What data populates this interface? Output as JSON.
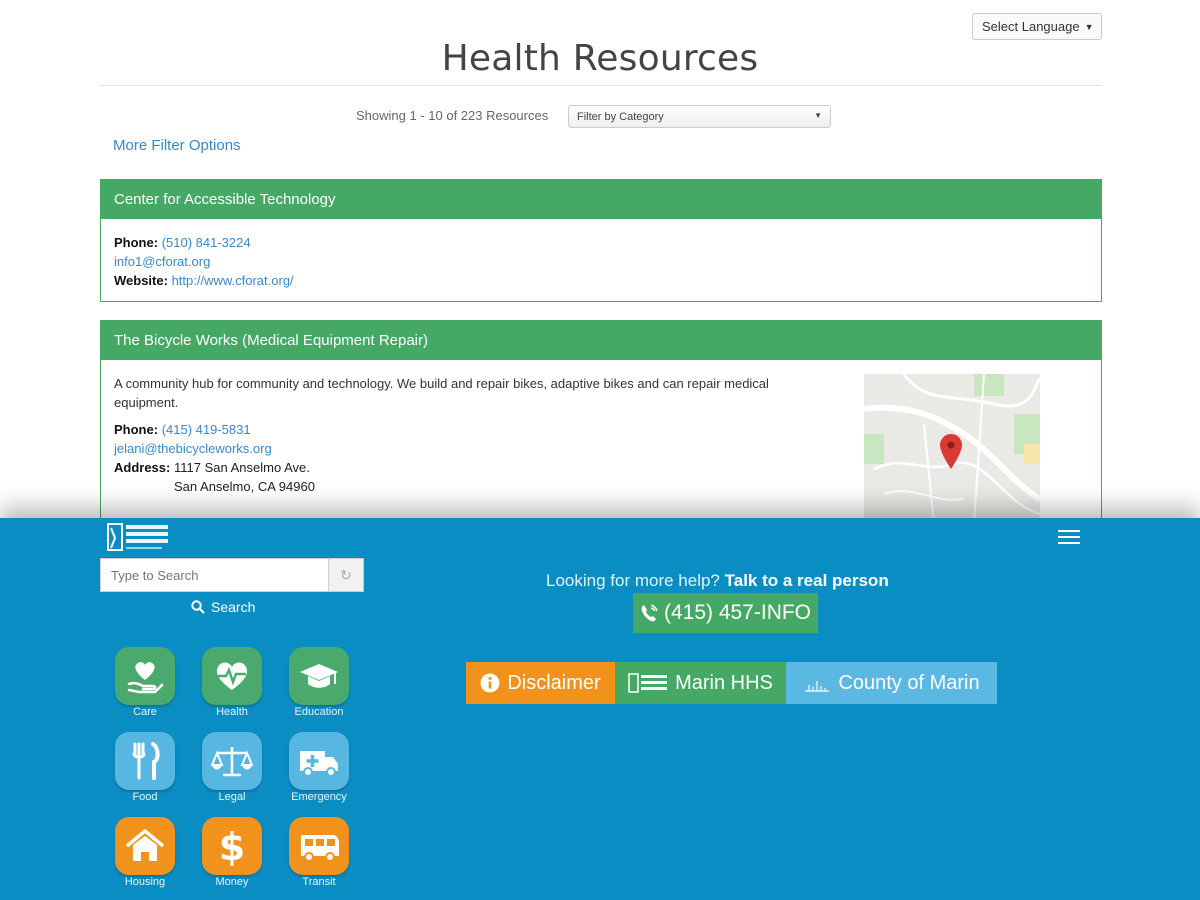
{
  "language_select": {
    "label": "Select Language"
  },
  "page": {
    "title": "Health Resources",
    "showing": "Showing 1 - 10 of 223 Resources",
    "category_filter": "Filter by Category",
    "more_filters": "More Filter Options"
  },
  "resources": [
    {
      "name": "Center for Accessible Technology",
      "phone_label": "Phone:",
      "phone": "(510) 841-3224",
      "email": "info1@cforat.org",
      "website_label": "Website:",
      "website": "http://www.cforat.org/"
    },
    {
      "name": "The Bicycle Works (Medical Equipment Repair)",
      "description": "A community hub for community and technology. We build and repair bikes, adaptive bikes and can repair medical equipment.",
      "phone_label": "Phone:",
      "phone": "(415) 419-5831",
      "email": "jelani@thebicycleworks.org",
      "address_label": "Address:",
      "address_line1": "1117 San Anselmo Ave.",
      "address_line2": "San Anselmo, CA 94960"
    }
  ],
  "footer": {
    "search_placeholder": "Type to Search",
    "search_label": "Search",
    "categories": [
      {
        "label": "Care",
        "icon": "hand-heart-icon",
        "color": "#4aaa6d"
      },
      {
        "label": "Health",
        "icon": "heartbeat-icon",
        "color": "#4aaa6d"
      },
      {
        "label": "Education",
        "icon": "graduation-cap-icon",
        "color": "#4aaa6d"
      },
      {
        "label": "Food",
        "icon": "fork-knife-icon",
        "color": "#58b7e0"
      },
      {
        "label": "Legal",
        "icon": "scales-icon",
        "color": "#58b7e0"
      },
      {
        "label": "Emergency",
        "icon": "ambulance-icon",
        "color": "#58b7e0"
      },
      {
        "label": "Housing",
        "icon": "house-icon",
        "color": "#f0921c"
      },
      {
        "label": "Money",
        "icon": "dollar-icon",
        "color": "#f0921c"
      },
      {
        "label": "Transit",
        "icon": "bus-icon",
        "color": "#f0921c"
      }
    ],
    "help_prefix": "Looking for more help?",
    "help_strong": "Talk to a real person",
    "phone": "(415) 457-INFO",
    "buttons": {
      "disclaimer": "Disclaimer",
      "marin_hhs": "Marin HHS",
      "county": "County of Marin"
    }
  },
  "colors": {
    "green": "#45a865",
    "blue": "#0a8dc2",
    "orange": "#f0921c",
    "light_blue": "#5ab8e2",
    "link": "#3a87c6"
  }
}
